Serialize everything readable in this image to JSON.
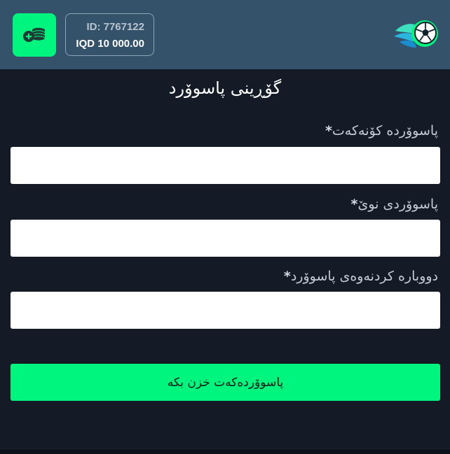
{
  "header": {
    "user_id": "ID: 7767122",
    "balance": "IQD 10 000.00",
    "deposit_icon": "coins-plus-icon",
    "logo_icon": "soccer-ball-logo-icon"
  },
  "form": {
    "title": "گۆڕینی پاسوۆرد",
    "required_mark": "*",
    "fields": [
      {
        "label": "پاسوۆردە کۆنەکەت",
        "value": "",
        "placeholder": ""
      },
      {
        "label": "پاسوۆردی نوێ",
        "value": "",
        "placeholder": ""
      },
      {
        "label": "دووبارە کردنەوەی پاسوۆرد",
        "value": "",
        "placeholder": ""
      }
    ],
    "submit_label": "پاسوۆردەکەت خزن بکە"
  },
  "colors": {
    "header_bg": "#34526a",
    "page_bg": "#141b26",
    "accent": "#00f57f"
  }
}
